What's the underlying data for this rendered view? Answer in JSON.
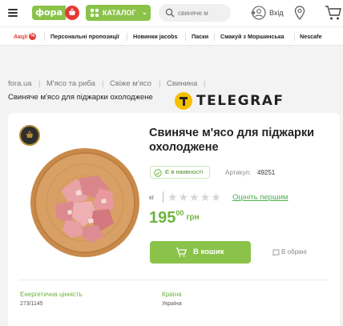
{
  "header": {
    "logo_text": "фора",
    "catalog_label": "КАТАЛОГ",
    "search": {
      "value": "свиняче м",
      "placeholder": ""
    },
    "login_label": "Вхід"
  },
  "promo_nav": {
    "items": [
      {
        "label": "Акції",
        "badge": "%",
        "accent": true
      },
      {
        "label": "Персональні пропозиції"
      },
      {
        "label": "Новинки jacobs"
      },
      {
        "label": "Паски"
      },
      {
        "label": "Смакуй з Моршинська"
      },
      {
        "label": "Nescafe"
      }
    ]
  },
  "breadcrumb": [
    "fora.ua",
    "М'ясо та риба",
    "Свіже м'ясо",
    "Свинина"
  ],
  "page_title": "Свиняче м'ясо для піджарки охолоджене",
  "watermark_text": "TELEGRAF",
  "product": {
    "title": "Свиняче м'ясо для піджарки охолоджене",
    "availability": "Є в наявності",
    "article_label": "Артикул:",
    "article_value": "49251",
    "unit": "кг",
    "rating": 0,
    "rating_max": 5,
    "review_link": "Оцініть першим",
    "price_int": "195",
    "price_frac": "00",
    "currency": "грн",
    "buy_label": "В кошик",
    "favorite_label": "В обрані"
  },
  "specs": [
    {
      "label": "Енергетична цінність",
      "value": "273/1145"
    },
    {
      "label": "Країна",
      "value": "Україна"
    }
  ],
  "colors": {
    "brand_green": "#8bc34a",
    "price_green": "#6db33f",
    "sale_red": "#e53935"
  }
}
